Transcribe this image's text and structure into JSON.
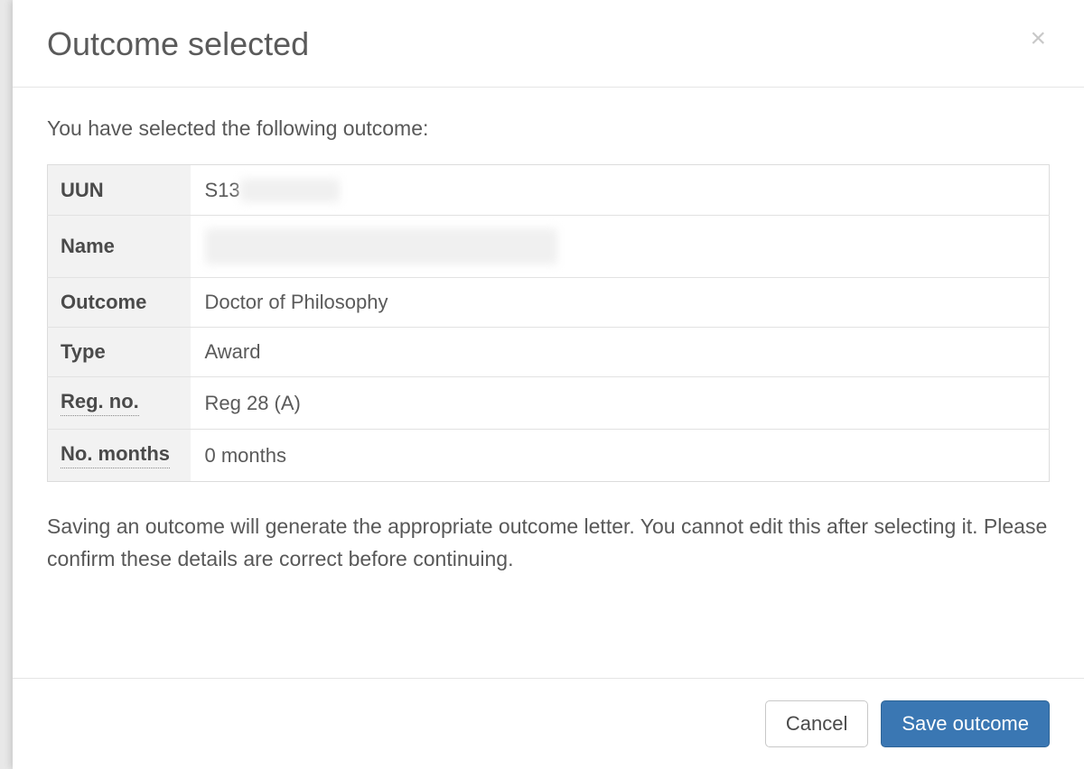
{
  "modal": {
    "title": "Outcome selected",
    "introText": "You have selected the following outcome:",
    "table": {
      "uunLabel": "UUN",
      "uunPrefix": "S13",
      "nameLabel": "Name",
      "outcomeLabel": "Outcome",
      "outcomeValue": "Doctor of Philosophy",
      "typeLabel": "Type",
      "typeValue": "Award",
      "regLabel": "Reg. no.",
      "regValue": "Reg 28 (A)",
      "monthsLabel": "No. months",
      "monthsValue": "0 months"
    },
    "infoText": "Saving an outcome will generate the appropriate outcome letter. You cannot edit this after selecting it. Please confirm these details are correct before continuing.",
    "footer": {
      "cancelLabel": "Cancel",
      "saveLabel": "Save outcome"
    }
  }
}
